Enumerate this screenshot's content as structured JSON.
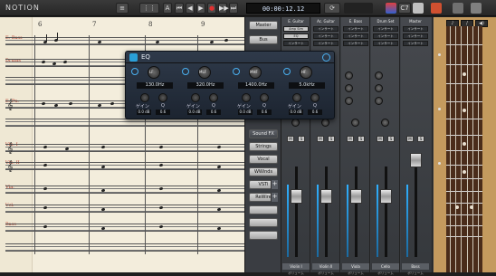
{
  "app": {
    "title": "NOTION"
  },
  "toolbar": {
    "time": "00:00:12.12",
    "mode_label": "A",
    "counter": "C7",
    "rec_symbol": "●"
  },
  "score": {
    "bar_numbers": [
      "6",
      "7",
      "8",
      "9"
    ],
    "instruments": [
      "E. Bass",
      "Drums",
      "E. Pn.",
      "Vln. I",
      "Vln. II",
      "Vla.",
      "Vcl.",
      "Bass"
    ]
  },
  "eq": {
    "title": "EQ",
    "bands": [
      {
        "type": "LF",
        "freq": "130.0Hz",
        "gain_label": "ゲイン",
        "q_label": "Q",
        "gain": "0.0 dB",
        "q": "0.6"
      },
      {
        "type": "MLF",
        "freq": "320.0Hz",
        "gain_label": "ゲイン",
        "q_label": "Q",
        "gain": "0.0 dB",
        "q": "0.6"
      },
      {
        "type": "MHF",
        "freq": "1400.0Hz",
        "gain_label": "ゲイン",
        "q_label": "Q",
        "gain": "0.0 dB",
        "q": "0.6"
      },
      {
        "type": "HF",
        "freq": "5.0kHz",
        "gain_label": "ゲイン",
        "q_label": "Q",
        "gain": "0.0 dB",
        "q": "0.6"
      }
    ]
  },
  "side_buttons": {
    "master": "Master",
    "bus": "Bus",
    "sound_fx": "Sound FX",
    "strings": "Strings",
    "vocal": "Vocal",
    "winds": "WWinds",
    "vsti": "VSTi",
    "rewire": "ReWire"
  },
  "mixer": {
    "strips": [
      {
        "name": "E. Guitar",
        "slots": [
          "Amp Sim",
          "EQ",
          "インサート"
        ],
        "footer": "Violin I",
        "sub": "ボリューム",
        "meter": 0.75,
        "fader": 0.45
      },
      {
        "name": "Ac. Guitar",
        "slots": [
          "インサート",
          "インサート",
          "インサート"
        ],
        "footer": "Violin II",
        "sub": "ボリューム",
        "meter": 0.6,
        "fader": 0.45
      },
      {
        "name": "E. Bass",
        "slots": [
          "インサート",
          "インサート",
          "インサート"
        ],
        "footer": "Viola",
        "sub": "ボリューム",
        "meter": 0.55,
        "fader": 0.45
      },
      {
        "name": "Drum Set",
        "slots": [
          "インサート",
          "インサート",
          "インサート"
        ],
        "footer": "Cello",
        "sub": "ボリューム",
        "meter": 0.5,
        "fader": 0.45
      },
      {
        "name": "Master",
        "slots": [
          "インサート",
          "インサート",
          "インサート"
        ],
        "footer": "Bass",
        "sub": "ボリューム",
        "meter": 0.8,
        "fader": 0.7
      }
    ],
    "mute": "M",
    "solo": "S"
  },
  "guitar": {
    "fret_count": 14
  }
}
